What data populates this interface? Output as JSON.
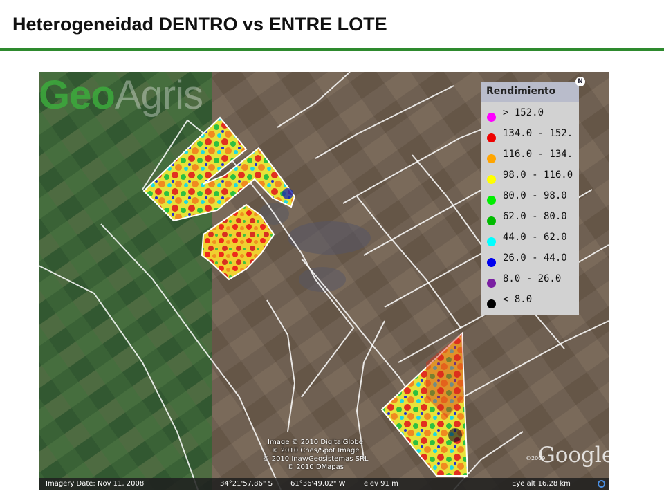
{
  "header": {
    "title": "Heterogeneidad DENTRO vs ENTRE LOTE"
  },
  "map": {
    "watermark": {
      "geo": "Geo",
      "agris": "Agris"
    },
    "north_symbol": "N",
    "legend": {
      "title": "Rendimiento",
      "items": [
        {
          "label": "> 152.0",
          "color": "#ff00ff"
        },
        {
          "label": "134.0 - 152.",
          "color": "#ee0000"
        },
        {
          "label": "116.0 - 134.",
          "color": "#ffa500"
        },
        {
          "label": "98.0 - 116.0",
          "color": "#ffff00"
        },
        {
          "label": "80.0 - 98.0",
          "color": "#00ee00"
        },
        {
          "label": "62.0 - 80.0",
          "color": "#00bb00"
        },
        {
          "label": "44.0 - 62.0",
          "color": "#00ffff"
        },
        {
          "label": "26.0 - 44.0",
          "color": "#0000ee"
        },
        {
          "label": "8.0 - 26.0",
          "color": "#7a1fa2"
        },
        {
          "label": "< 8.0",
          "color": "#000000"
        }
      ]
    },
    "copyright": [
      "Image © 2010 DigitalGlobe",
      "© 2010 Cnes/Spot Image",
      "© 2010 Inav/Geosistemas SRL",
      "© 2010 DMapas"
    ],
    "provider": {
      "logo": "Google",
      "year": "©2009"
    },
    "status_bar": {
      "imagery_date": "Imagery Date: Nov 11, 2008",
      "latitude": "34°21'57.86\" S",
      "longitude": "61°36'49.02\" W",
      "elevation": "elev   91 m",
      "eye_alt": "Eye alt   16.28 km"
    }
  }
}
